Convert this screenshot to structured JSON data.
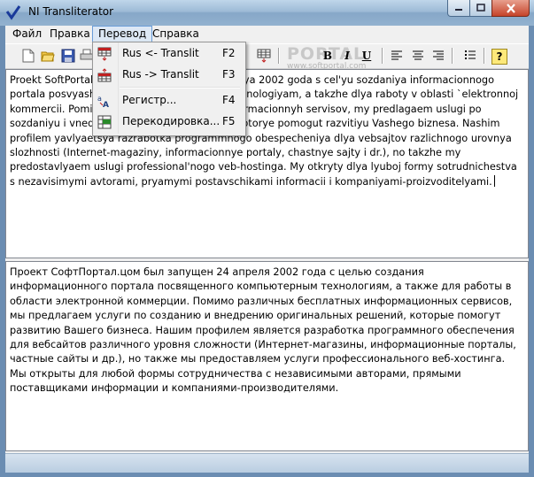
{
  "window": {
    "title": "NI Transliterator"
  },
  "menu": {
    "items": [
      "Файл",
      "Правка",
      "Перевод",
      "Справка"
    ],
    "active": "Перевод"
  },
  "dropdown": {
    "items": [
      {
        "label": "Rus <- Translit",
        "shortcut": "F2",
        "icon": "translit-to-rus-icon"
      },
      {
        "label": "Rus -> Translit",
        "shortcut": "F3",
        "icon": "rus-to-translit-icon"
      },
      {
        "label": "Регистр...",
        "shortcut": "F4",
        "icon": "register-icon"
      },
      {
        "label": "Перекодировка...",
        "shortcut": "F5",
        "icon": "recode-icon"
      }
    ]
  },
  "toolbar": {
    "buttons": [
      "new-file-icon",
      "open-folder-icon",
      "save-icon",
      "bold-icon",
      "italic-icon",
      "underline-icon",
      "align-left-icon",
      "align-center-icon",
      "align-right-icon",
      "list-icon",
      "help-icon"
    ],
    "bold_label": "B",
    "italic_label": "I",
    "underline_label": "U",
    "help_label": "?"
  },
  "watermark": {
    "text": "PORTAL",
    "url": "www.softportal.com"
  },
  "editor": {
    "translit_text": "Proekt SoftPortal.com byl zapushchen 24 aprelya 2002 goda s cel'yu sozdaniya informacionnogo portala posvyashchennogo komp'yuternym tehnologiyam, a takzhe dlya raboty v oblasti `elektronnoj kommercii. Pomimo razlichnyh besplatnyh informacionnyh servisov, my predlagaem uslugi po sozdaniyu i vnedreniyu original'nyh reshenij, kotorye pomogut razvitiyu Vashego biznesa. Nashim profilem yavlyaetsya razrabotka programmnogo obespecheniya dlya vebsajtov razlichnogo urovnya slozhnosti (Internet-magaziny, informacionnye portaly, chastnye sajty i dr.), no takzhe my predostavlyaem uslugi professional'nogo veb-hostinga. My otkryty dlya lyuboj formy sotrudnichestva s nezavisimymi avtorami, pryamymi postavschikami informacii i kompaniyami-proizvoditelyami.",
    "russian_text": "Проект СофтПортал.цом был запущен 24 апреля 2002 года с целью создания информационного портала посвященного компьютерным технологиям, а также для работы в области электронной коммерции. Помимо различных бесплатных информационных сервисов, мы предлагаем услуги по созданию и внедрению оригинальных решений, которые помогут развитию Вашего бизнеса. Нашим профилем является разработка программного обеспечения для вебсайтов различного уровня сложности (Интернет-магазины, информационные порталы, частные сайты и др.), но также мы предоставляем услуги профессионального веб-хостинга. Мы открыты для любой формы сотрудничества с независимыми авторами, прямыми поставщиками информации и компаниями-производителями."
  }
}
